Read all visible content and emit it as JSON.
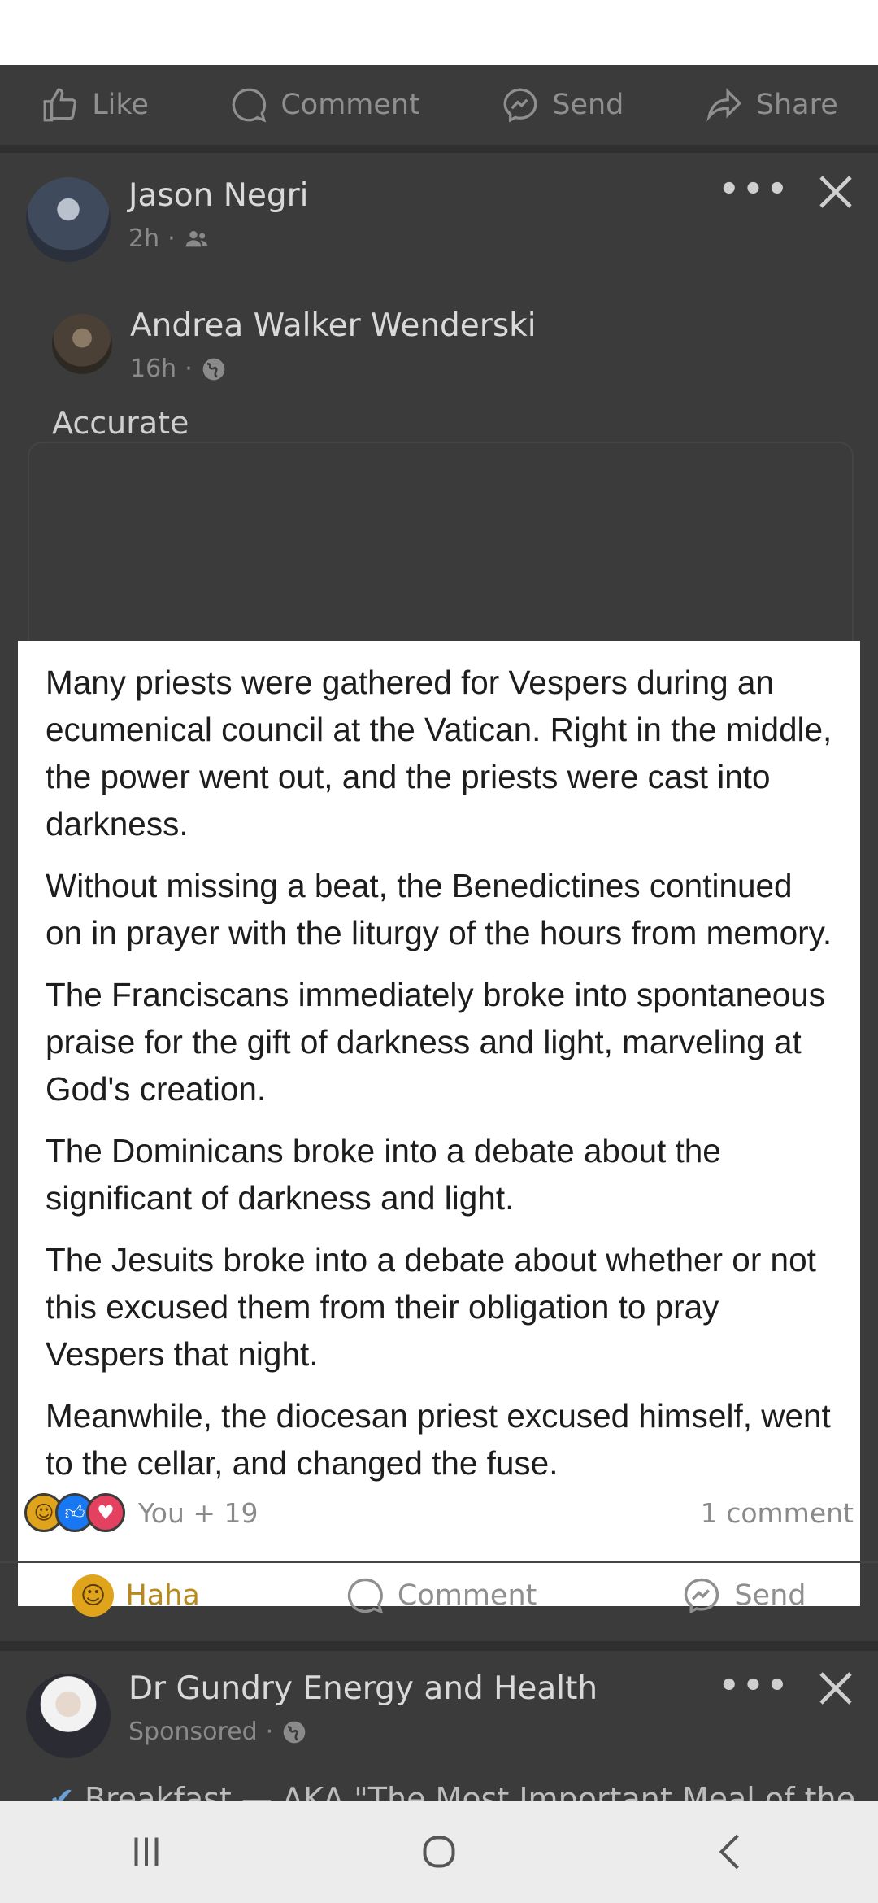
{
  "top_actions": {
    "like": "Like",
    "comment": "Comment",
    "send": "Send",
    "share": "Share"
  },
  "post": {
    "author": "Jason Negri",
    "time": "2h",
    "audience_icon": "friends-icon",
    "shared": {
      "author": "Andrea Walker Wenderski",
      "time": "16h",
      "audience_icon": "globe-icon",
      "text": "Accurate"
    },
    "quote_paragraphs": [
      "Many priests were gathered for Vespers during an ecumenical council at the Vatican. Right in the middle, the power went out, and the priests were cast into darkness.",
      "Without missing a beat, the Benedictines continued on in prayer with the liturgy of the hours from memory.",
      "The Franciscans immediately broke into spontaneous praise for the gift of darkness and light, marveling at God's creation.",
      "The Dominicans broke into a debate about the significant of darkness and light.",
      "The Jesuits broke into a debate about whether or not this excused them from their obligation to pray Vespers that night.",
      "Meanwhile, the diocesan priest excused himself, went to the cellar, and changed the fuse."
    ],
    "reactions_text": "You + 19",
    "comments_text": "1 comment",
    "actions": {
      "haha": "Haha",
      "comment": "Comment",
      "send": "Send"
    }
  },
  "post2": {
    "author": "Dr Gundry Energy and Health",
    "label": "Sponsored",
    "preview": "Breakfast — AKA \"The Most Important Meal of the"
  },
  "colors": {
    "haha": "#e0a31c",
    "like": "#1877f2",
    "love": "#e4405f"
  }
}
